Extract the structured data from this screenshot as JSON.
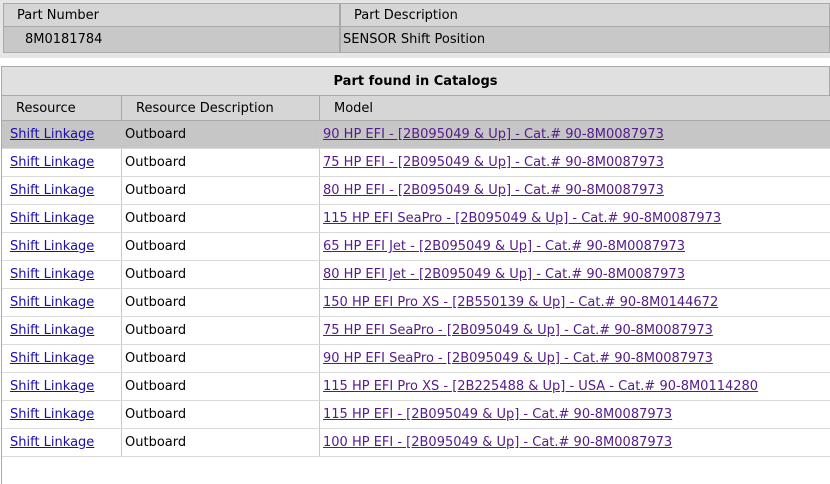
{
  "part_info": {
    "headers": {
      "part_number": "Part Number",
      "part_description": "Part Description"
    },
    "part_number": "8M0181784",
    "part_description": "SENSOR Shift Position"
  },
  "catalogs": {
    "title": "Part found in Catalogs",
    "columns": {
      "resource": "Resource",
      "resource_description": "Resource Description",
      "model": "Model"
    },
    "rows": [
      {
        "resource": "Shift Linkage",
        "description": "Outboard",
        "model": "90 HP EFI - [2B095049 & Up] - Cat.# 90-8M0087973"
      },
      {
        "resource": "Shift Linkage",
        "description": "Outboard",
        "model": "75 HP EFI - [2B095049 & Up] - Cat.# 90-8M0087973"
      },
      {
        "resource": "Shift Linkage",
        "description": "Outboard",
        "model": "80 HP EFI - [2B095049 & Up] - Cat.# 90-8M0087973"
      },
      {
        "resource": "Shift Linkage",
        "description": "Outboard",
        "model": "115 HP EFI SeaPro - [2B095049 & Up] - Cat.# 90-8M0087973"
      },
      {
        "resource": "Shift Linkage",
        "description": "Outboard",
        "model": "65 HP EFI Jet - [2B095049 & Up] - Cat.# 90-8M0087973"
      },
      {
        "resource": "Shift Linkage",
        "description": "Outboard",
        "model": "80 HP EFI Jet - [2B095049 & Up] - Cat.# 90-8M0087973"
      },
      {
        "resource": "Shift Linkage",
        "description": "Outboard",
        "model": "150 HP EFI Pro XS - [2B550139 & Up] - Cat.# 90-8M0144672"
      },
      {
        "resource": "Shift Linkage",
        "description": "Outboard",
        "model": "75 HP EFI SeaPro - [2B095049 & Up] - Cat.# 90-8M0087973"
      },
      {
        "resource": "Shift Linkage",
        "description": "Outboard",
        "model": "90 HP EFI SeaPro - [2B095049 & Up] - Cat.# 90-8M0087973"
      },
      {
        "resource": "Shift Linkage",
        "description": "Outboard",
        "model": "115 HP EFI Pro XS - [2B225488 & Up] - USA - Cat.# 90-8M0114280"
      },
      {
        "resource": "Shift Linkage",
        "description": "Outboard",
        "model": "115 HP EFI - [2B095049 & Up] - Cat.# 90-8M0087973"
      },
      {
        "resource": "Shift Linkage",
        "description": "Outboard",
        "model": "100 HP EFI - [2B095049 & Up] - Cat.# 90-8M0087973"
      }
    ]
  }
}
